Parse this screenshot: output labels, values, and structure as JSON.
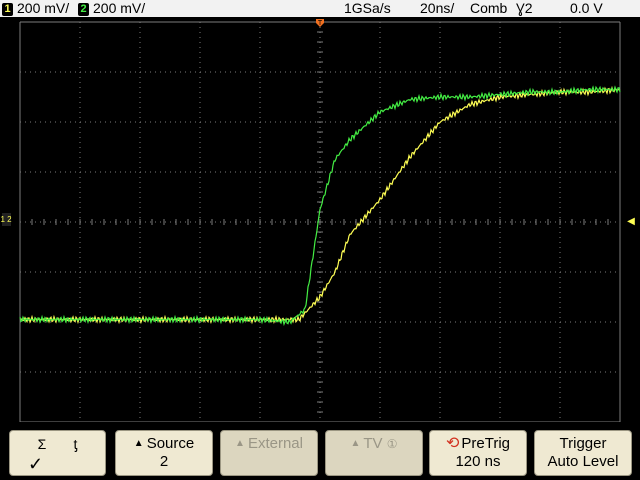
{
  "status": {
    "ch1": {
      "number": "1",
      "scale": "200 mV/"
    },
    "ch2": {
      "number": "2",
      "scale": "200 mV/"
    },
    "sample_rate": "1GSa/s",
    "timebase": "20ns/",
    "trigger_mode": "Comb",
    "trigger_slope_source": "Ɣ2",
    "trigger_level": "0.0 V"
  },
  "markers": {
    "trigger_position": "T",
    "ground_reference": "1 2",
    "trigger_level_arrow": "◀"
  },
  "softkeys": {
    "slope": {
      "rising": "Ʃ",
      "falling": "ƫ",
      "check": "✓"
    },
    "source": {
      "label": "Source",
      "value": "2"
    },
    "external": {
      "label": "External"
    },
    "tv": {
      "label": "TV",
      "badge": "①"
    },
    "pretrig": {
      "label": "PreTrig",
      "value": "120 ns"
    },
    "trigger": {
      "label": "Trigger",
      "value": "Auto Level"
    }
  },
  "colors": {
    "ch1": "#ffff55",
    "ch2": "#44ee44",
    "grid": "#7d7d7d",
    "trigger_marker": "#f07020"
  },
  "waveforms": {
    "x_unit": "ns",
    "y_unit": "V",
    "x_range": [
      -100,
      100
    ],
    "y_range": [
      -0.8,
      0.8
    ],
    "ch1": {
      "name": "1",
      "x": [
        -100,
        -50,
        -20,
        -7,
        0,
        5,
        10,
        20,
        30,
        40,
        50,
        60,
        70,
        80,
        90,
        100
      ],
      "y": [
        -0.39,
        -0.39,
        -0.39,
        -0.39,
        -0.3,
        -0.2,
        -0.05,
        0.09,
        0.26,
        0.4,
        0.47,
        0.5,
        0.51,
        0.52,
        0.52,
        0.53
      ]
    },
    "ch2": {
      "name": "2",
      "x": [
        -100,
        -50,
        -20,
        -10,
        -5,
        0,
        5,
        10,
        20,
        30,
        40,
        50,
        60,
        70,
        80,
        90,
        100
      ],
      "y": [
        -0.39,
        -0.39,
        -0.39,
        -0.4,
        -0.35,
        0.05,
        0.25,
        0.33,
        0.44,
        0.49,
        0.5,
        0.5,
        0.51,
        0.52,
        0.52,
        0.53,
        0.53
      ]
    }
  }
}
